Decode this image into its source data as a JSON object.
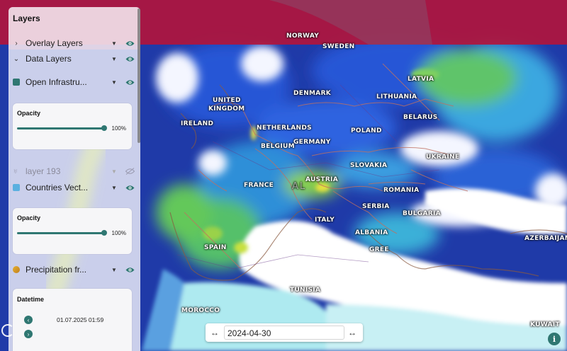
{
  "panel": {
    "title": "Layers",
    "overlay_layers": "Overlay Layers",
    "data_layers": "Data Layers",
    "open_infra": "Open Infrastru...",
    "opacity_label": "Opacity",
    "opacity_1_value": "100%",
    "layer193": "layer 193",
    "countries_vect": "Countries Vect...",
    "opacity_2_value": "100%",
    "precipitation": "Precipitation fr...",
    "datetime_label": "Datetime",
    "datetime_value": "01.07.2025 01:59"
  },
  "datebar": {
    "value": "2024-04-30",
    "prev": "↔",
    "next": "↔"
  },
  "info_label": "i",
  "countries": [
    {
      "key": "norway",
      "name": "NORWAY"
    },
    {
      "key": "sweden",
      "name": "SWEDEN"
    },
    {
      "key": "latvia",
      "name": "LATVIA"
    },
    {
      "key": "denmark",
      "name": "DENMARK"
    },
    {
      "key": "lithuania",
      "name": "LITHUANIA"
    },
    {
      "key": "united",
      "name": "UNITED"
    },
    {
      "key": "kingdom",
      "name": "KINGDOM"
    },
    {
      "key": "belarus",
      "name": "BELARUS"
    },
    {
      "key": "ireland",
      "name": "IRELAND"
    },
    {
      "key": "netherlands",
      "name": "NETHERLANDS"
    },
    {
      "key": "poland",
      "name": "POLAND"
    },
    {
      "key": "belgium",
      "name": "BELGIUM"
    },
    {
      "key": "germany",
      "name": "GERMANY"
    },
    {
      "key": "ukraine",
      "name": "UKRAINE"
    },
    {
      "key": "slovakia",
      "name": "SLOVAKIA"
    },
    {
      "key": "austria",
      "name": "AUSTRIA"
    },
    {
      "key": "france",
      "name": "FRANCE"
    },
    {
      "key": "romania",
      "name": "ROMANIA"
    },
    {
      "key": "serbia",
      "name": "SERBIA"
    },
    {
      "key": "bulgaria",
      "name": "BULGARIA"
    },
    {
      "key": "italy",
      "name": "ITALY"
    },
    {
      "key": "albania",
      "name": "ALBANIA"
    },
    {
      "key": "spain",
      "name": "SPAIN"
    },
    {
      "key": "greece",
      "name": "GREE"
    },
    {
      "key": "azerbaijan",
      "name": "AZERBAIJAN"
    },
    {
      "key": "tunisia",
      "name": "TUNISIA"
    },
    {
      "key": "morocco",
      "name": "MOROCCO"
    },
    {
      "key": "kuwait",
      "name": "KUWAIT"
    },
    {
      "key": "alps",
      "name": "AL"
    }
  ],
  "colors": {
    "accent": "#2f7772",
    "norway_overlay": "#b4143a",
    "radar_blue": "#1d2f8f",
    "radar_green": "#58c25a",
    "radar_yellow": "#e6e040",
    "sea_cyan": "#aeeaf0"
  }
}
